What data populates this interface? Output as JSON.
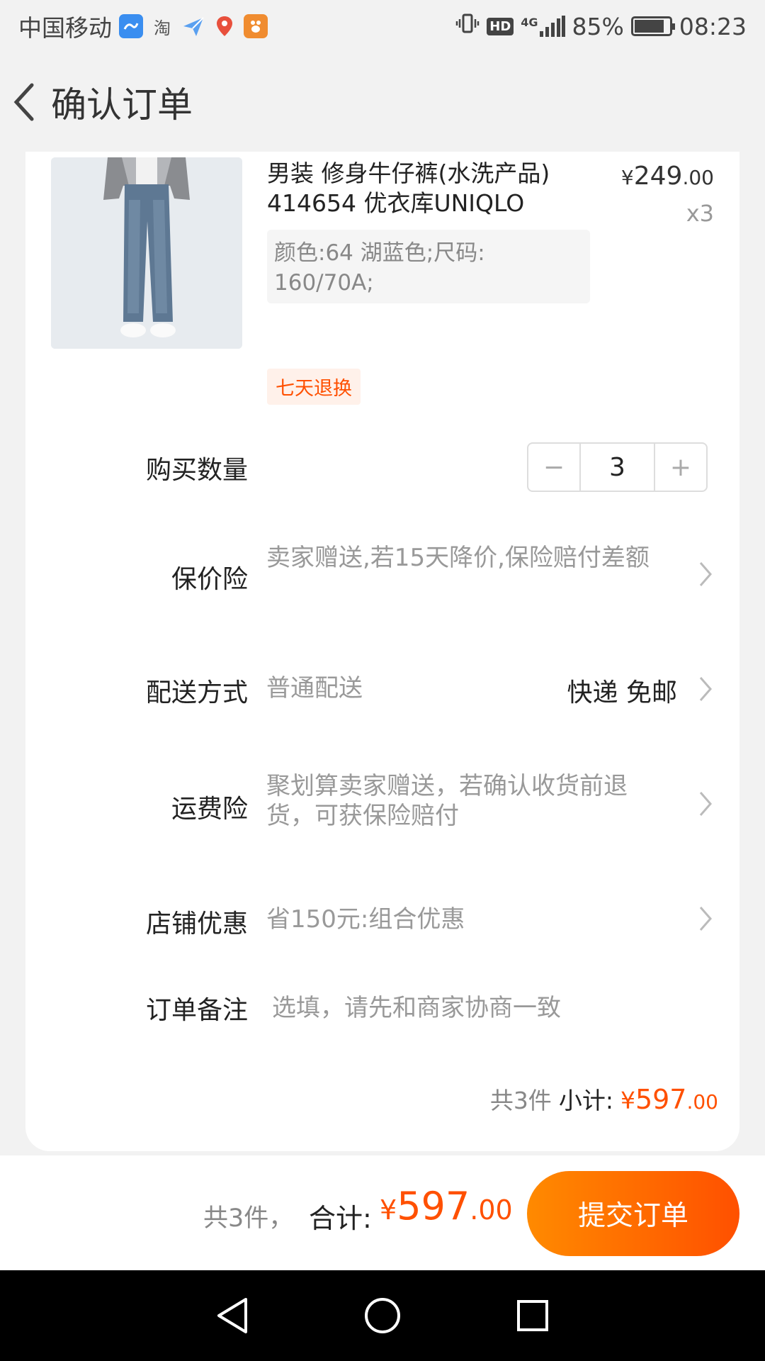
{
  "status_bar": {
    "carrier": "中国移动",
    "apps": [
      "huanxin-app-icon",
      "taobao-app-icon",
      "paperplane-app-icon",
      "map-app-icon",
      "baidu-app-icon"
    ],
    "taobao_label": "淘",
    "network": "4G",
    "hd": "HD",
    "battery": "85%",
    "battery_level": 0.85,
    "time": "08:23"
  },
  "nav": {
    "title": "确认订单"
  },
  "product": {
    "title": "男装 修身牛仔裤(水洗产品) 414654 优衣库UNIQLO",
    "sku": "颜色:64 湖蓝色;尺码: 160/70A;",
    "price_symbol": "¥",
    "price_int": "249",
    "price_dec": ".00",
    "qty_label": "x3",
    "tag": "七天退换"
  },
  "rows": {
    "quantity_label": "购买数量",
    "quantity_value": "3",
    "minus": "−",
    "plus": "+",
    "price_protect_label": "保价险",
    "price_protect_value": "卖家赠送,若15天降价,保险赔付差额",
    "delivery_label": "配送方式",
    "delivery_value": "普通配送",
    "delivery_right": "快递 免邮",
    "shipping_insurance_label": "运费险",
    "shipping_insurance_value": "聚划算卖家赠送，若确认收货前退货，可获保险赔付",
    "store_discount_label": "店铺优惠",
    "store_discount_value": "省150元:组合优惠",
    "note_label": "订单备注",
    "note_placeholder": "选填，请先和商家协商一致"
  },
  "subtotal": {
    "count": "共3件",
    "label": "小计:",
    "symbol": "¥",
    "amount": "597",
    "dec": ".00"
  },
  "bottom": {
    "count": "共3件，",
    "total_label": "合计:",
    "symbol": "¥",
    "amount": "597",
    "dec": ".00",
    "submit": "提交订单"
  },
  "colors": {
    "accent": "#ff5000",
    "accent_gradient_start": "#ff8a00"
  }
}
